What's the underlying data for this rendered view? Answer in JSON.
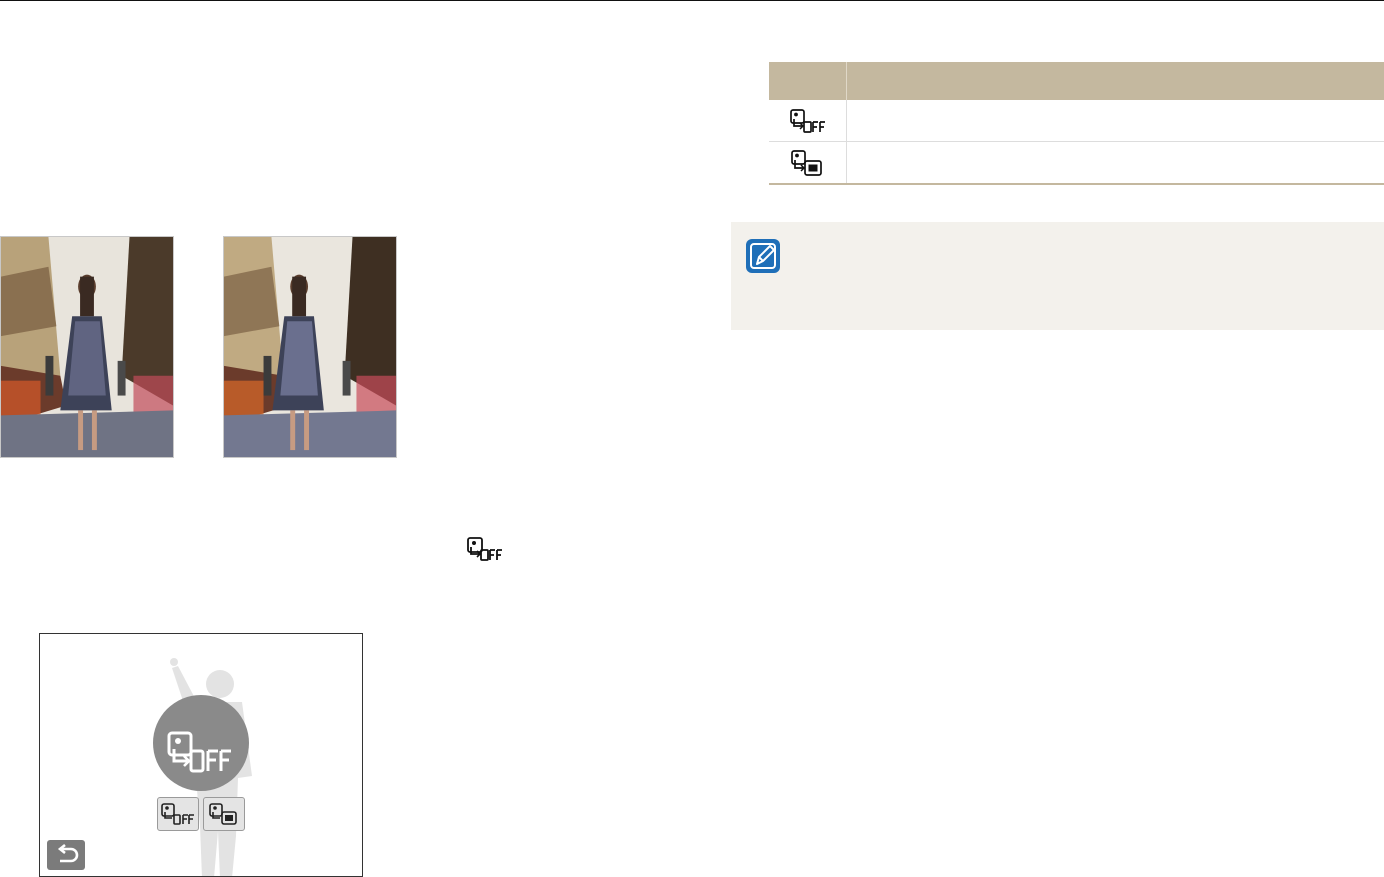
{
  "table": {
    "header": {
      "icon_col": "",
      "desc_col": ""
    },
    "rows": [
      {
        "icon": "smart-filter-off-icon",
        "description": ""
      },
      {
        "icon": "smart-filter-on-icon",
        "description": ""
      }
    ]
  },
  "photos": [
    {
      "icon": "photo-woman-street"
    },
    {
      "icon": "photo-woman-street"
    }
  ],
  "camera_screen": {
    "selected_option_icon": "smart-filter-off-icon",
    "options": [
      "smart-filter-off-icon",
      "smart-filter-on-icon"
    ],
    "back_icon": "back-arrow-icon"
  },
  "note": {
    "icon": "note-pencil-icon",
    "text": ""
  },
  "colors": {
    "table_header": "#c4b89f",
    "note_background": "#f3f1ec",
    "note_icon": "#1f6fb8"
  }
}
